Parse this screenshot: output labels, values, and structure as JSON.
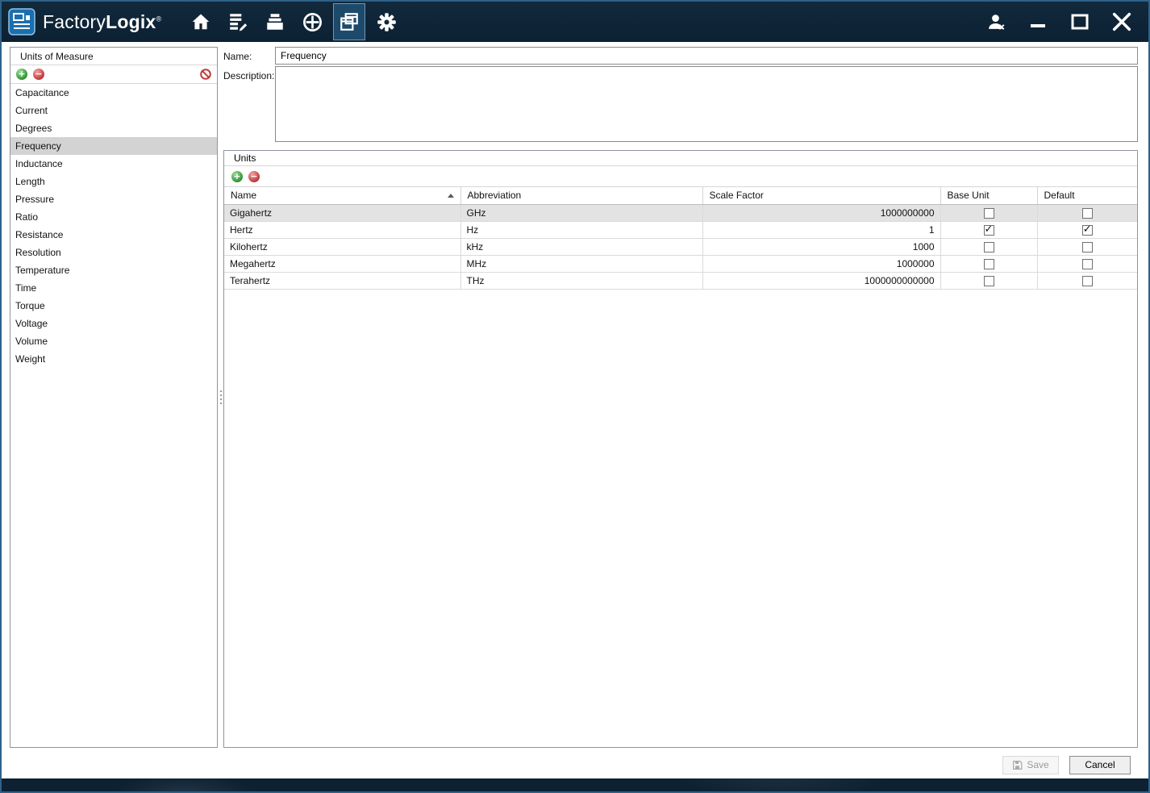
{
  "titlebar": {
    "brand_1": "Factory",
    "brand_2": "Logix",
    "brand_reg": "®"
  },
  "sidebar": {
    "title": "Units of Measure",
    "selected_item": "Frequency",
    "items": [
      "Capacitance",
      "Current",
      "Degrees",
      "Frequency",
      "Inductance",
      "Length",
      "Pressure",
      "Ratio",
      "Resistance",
      "Resolution",
      "Temperature",
      "Time",
      "Torque",
      "Voltage",
      "Volume",
      "Weight"
    ]
  },
  "form": {
    "name_label": "Name:",
    "name_value": "Frequency",
    "description_label": "Description:",
    "description_value": ""
  },
  "units": {
    "title": "Units",
    "columns": {
      "name": "Name",
      "abbreviation": "Abbreviation",
      "scale_factor": "Scale Factor",
      "base_unit": "Base Unit",
      "default": "Default"
    },
    "sort": {
      "column": "Name",
      "direction": "ascending"
    },
    "rows": [
      {
        "name": "Gigahertz",
        "abbreviation": "GHz",
        "scale_factor": "1000000000",
        "base_unit": false,
        "default": false,
        "selected": true
      },
      {
        "name": "Hertz",
        "abbreviation": "Hz",
        "scale_factor": "1",
        "base_unit": true,
        "default": true,
        "selected": false
      },
      {
        "name": "Kilohertz",
        "abbreviation": "kHz",
        "scale_factor": "1000",
        "base_unit": false,
        "default": false,
        "selected": false
      },
      {
        "name": "Megahertz",
        "abbreviation": "MHz",
        "scale_factor": "1000000",
        "base_unit": false,
        "default": false,
        "selected": false
      },
      {
        "name": "Terahertz",
        "abbreviation": "THz",
        "scale_factor": "1000000000000",
        "base_unit": false,
        "default": false,
        "selected": false
      }
    ]
  },
  "footer": {
    "save_label": "Save",
    "cancel_label": "Cancel"
  }
}
